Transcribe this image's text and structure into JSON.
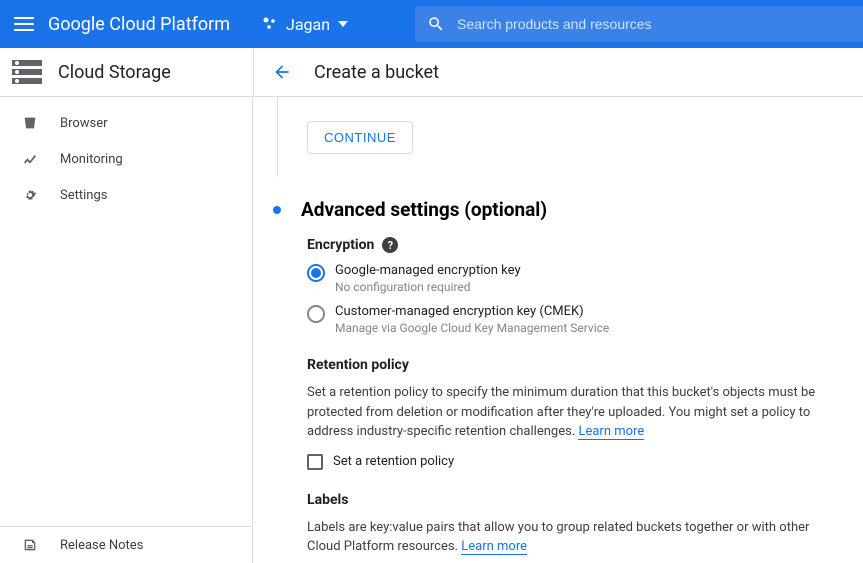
{
  "topbar": {
    "logo": "Google Cloud Platform",
    "project": "Jagan",
    "search_placeholder": "Search products and resources"
  },
  "subheader": {
    "product": "Cloud Storage",
    "page": "Create a bucket"
  },
  "sidebar": {
    "items": [
      {
        "label": "Browser"
      },
      {
        "label": "Monitoring"
      },
      {
        "label": "Settings"
      }
    ],
    "footer": {
      "label": "Release Notes"
    }
  },
  "main": {
    "continue_label": "CONTINUE",
    "step_title": "Advanced settings (optional)",
    "encryption": {
      "heading": "Encryption",
      "options": [
        {
          "label": "Google-managed encryption key",
          "sub": "No configuration required",
          "selected": true
        },
        {
          "label": "Customer-managed encryption key (CMEK)",
          "sub": "Manage via Google Cloud Key Management Service",
          "selected": false
        }
      ]
    },
    "retention": {
      "heading": "Retention policy",
      "body": "Set a retention policy to specify the minimum duration that this bucket's objects must be protected from deletion or modification after they're uploaded. You might set a policy to address industry-specific retention challenges. ",
      "learn_more": "Learn more",
      "checkbox_label": "Set a retention policy"
    },
    "labels": {
      "heading": "Labels",
      "body": "Labels are key:value pairs that allow you to group related buckets together or with other Cloud Platform resources. ",
      "learn_more": "Learn more"
    }
  }
}
